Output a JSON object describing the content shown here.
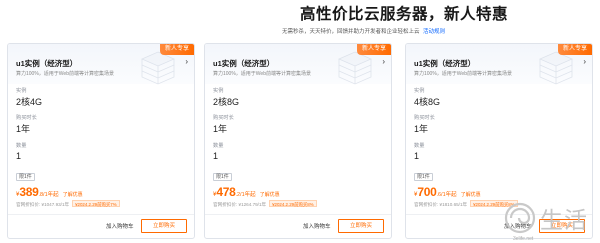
{
  "page": {
    "title": "高性价比云服务器，新人特惠",
    "subtitle": "无需秒杀，天天特价，回馈并助力开发者和企业轻松上云",
    "subtitle_link": "活动规则"
  },
  "cards": [
    {
      "badge": "新人专享",
      "title": "u1实例（经济型）",
      "desc": "算力100%，适用于Web前端等计算密集场景",
      "spec_label": "实例",
      "spec_value": "2核4G",
      "duration_label": "购买时长",
      "duration_value": "1年",
      "qty_label": "数量",
      "qty_value": "1",
      "tag": "限1件",
      "currency": "¥",
      "price": "389",
      "price_unit": ".8/1年起",
      "more": "了解优惠",
      "orig": "官网折扣价: ¥1047.93/1年",
      "promo": "¥2024.2.29前购买7%",
      "cart": "加入购物车",
      "buy": "立即购买"
    },
    {
      "badge": "新人专享",
      "title": "u1实例（经济型）",
      "desc": "算力100%，适用于Web前端等计算密集场景",
      "spec_label": "实例",
      "spec_value": "2核8G",
      "duration_label": "购买时长",
      "duration_value": "1年",
      "qty_label": "数量",
      "qty_value": "1",
      "tag": "限1件",
      "currency": "¥",
      "price": "478",
      "price_unit": ".2/1年起",
      "more": "了解优惠",
      "orig": "官网折扣价: ¥1264.79/1年",
      "promo": "¥2024.2.29前购买8%",
      "cart": "加入购物车",
      "buy": "立即购买"
    },
    {
      "badge": "新人专享",
      "title": "u1实例（经济型）",
      "desc": "算力100%，适用于Web前端等计算密集场景",
      "spec_label": "实例",
      "spec_value": "4核8G",
      "duration_label": "购买时长",
      "duration_value": "1年",
      "qty_label": "数量",
      "qty_value": "1",
      "tag": "限1件",
      "currency": "¥",
      "price": "700",
      "price_unit": ".6/1年起",
      "more": "了解优惠",
      "orig": "官网折扣价: ¥1810.65/1年",
      "promo": "¥2024.2.29前购买8%",
      "cart": "加入购物车",
      "buy": "立即购买"
    }
  ],
  "watermark": {
    "text": "生活",
    "url": "3elife.net",
    "icon": "swirl-logo-icon"
  },
  "colors": {
    "accent": "#ff6a00",
    "link": "#0a66ff",
    "border": "#dfe3ea"
  }
}
